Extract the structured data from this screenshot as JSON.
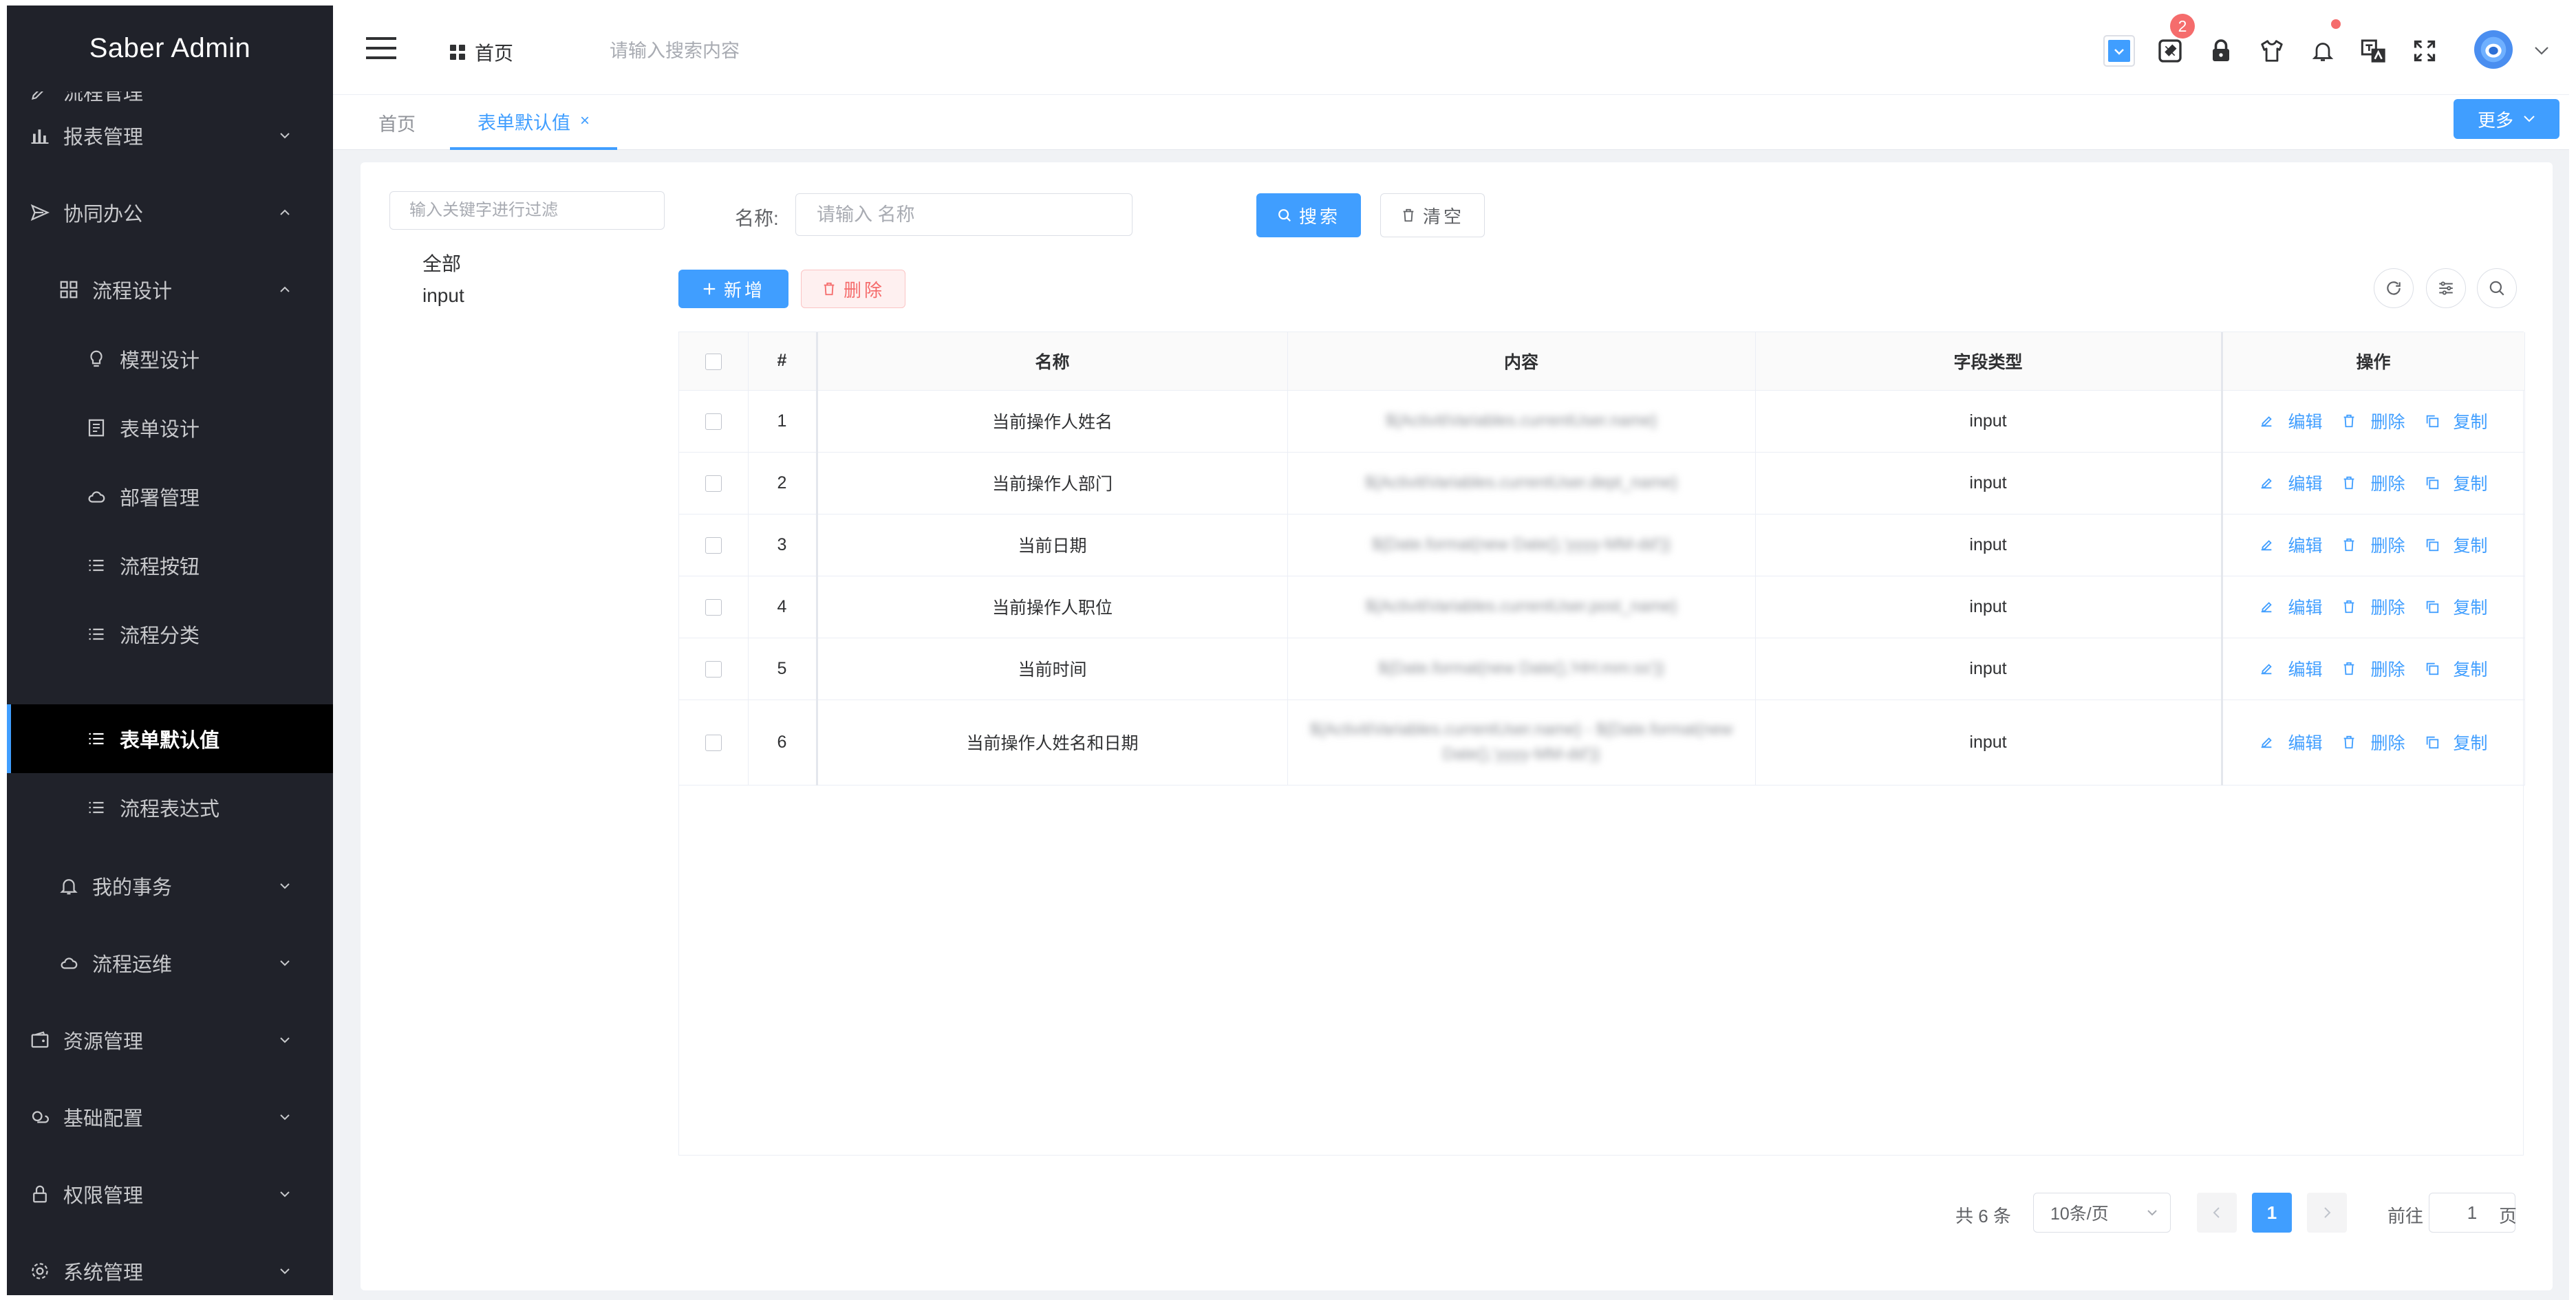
{
  "app": {
    "title": "Saber Admin"
  },
  "sidebar": {
    "partial_item": "流程管理",
    "items": [
      {
        "label": "报表管理",
        "icon": "bar-chart-icon",
        "expanded": false
      },
      {
        "label": "协同办公",
        "icon": "send-icon",
        "expanded": true
      },
      {
        "label": "流程设计",
        "icon": "grid-icon",
        "expanded": true
      },
      {
        "label": "模型设计",
        "icon": "bulb-icon"
      },
      {
        "label": "表单设计",
        "icon": "document-icon"
      },
      {
        "label": "部署管理",
        "icon": "cloud-icon"
      },
      {
        "label": "流程按钮",
        "icon": "list-icon"
      },
      {
        "label": "流程分类",
        "icon": "list-icon"
      },
      {
        "label": "表单默认值",
        "icon": "list-icon",
        "active": true
      },
      {
        "label": "流程表达式",
        "icon": "list-icon"
      },
      {
        "label": "我的事务",
        "icon": "bell-icon",
        "expanded": false
      },
      {
        "label": "流程运维",
        "icon": "cloud-icon",
        "expanded": false
      },
      {
        "label": "资源管理",
        "icon": "wallet-icon",
        "expanded": false
      },
      {
        "label": "基础配置",
        "icon": "cloudy-icon",
        "expanded": false
      },
      {
        "label": "权限管理",
        "icon": "lock-icon",
        "expanded": false
      },
      {
        "label": "系统管理",
        "icon": "gear-icon",
        "expanded": false
      }
    ]
  },
  "header": {
    "home_label": "首页",
    "search_placeholder": "请输入搜索内容",
    "notification_count": "2"
  },
  "tabs": {
    "items": [
      {
        "label": "首页",
        "active": false
      },
      {
        "label": "表单默认值",
        "active": true
      }
    ],
    "close_symbol": "×",
    "more_label": "更多"
  },
  "tree": {
    "filter_placeholder": "输入关键字进行过滤",
    "nodes": [
      "全部",
      "input"
    ]
  },
  "search_form": {
    "name_label": "名称:",
    "name_placeholder": "请输入 名称",
    "search_button": "搜索",
    "clear_button": "清空"
  },
  "toolbar": {
    "add_button": "新增",
    "delete_button": "删除"
  },
  "table": {
    "columns": [
      "#",
      "名称",
      "内容",
      "字段类型",
      "操作"
    ],
    "rows": [
      {
        "index": "1",
        "name": "当前操作人姓名",
        "content": "${ActivitiVariables.currentUser.name}",
        "type": "input"
      },
      {
        "index": "2",
        "name": "当前操作人部门",
        "content": "${ActivitiVariables.currentUser.dept_name}",
        "type": "input"
      },
      {
        "index": "3",
        "name": "当前日期",
        "content": "${Date.format(new Date(),'yyyy-MM-dd')}",
        "type": "input"
      },
      {
        "index": "4",
        "name": "当前操作人职位",
        "content": "${ActivitiVariables.currentUser.post_name}",
        "type": "input"
      },
      {
        "index": "5",
        "name": "当前时间",
        "content": "${Date.format(new Date(),'HH:mm:ss')}",
        "type": "input"
      },
      {
        "index": "6",
        "name": "当前操作人姓名和日期",
        "content": "${ActivitiVariables.currentUser.name} - ${Date.format(new Date(),'yyyy-MM-dd')}",
        "type": "input"
      }
    ],
    "actions": {
      "edit": "编辑",
      "delete": "删除",
      "copy": "复制"
    }
  },
  "pagination": {
    "total_text": "共 6 条",
    "page_size": "10条/页",
    "current_page": "1",
    "goto_prefix": "前往",
    "goto_value": "1",
    "goto_suffix": "页"
  },
  "colors": {
    "sidebar_bg": "#20222a",
    "active_item_bg": "#000000",
    "primary": "#409eff",
    "danger": "#f56c6c"
  }
}
